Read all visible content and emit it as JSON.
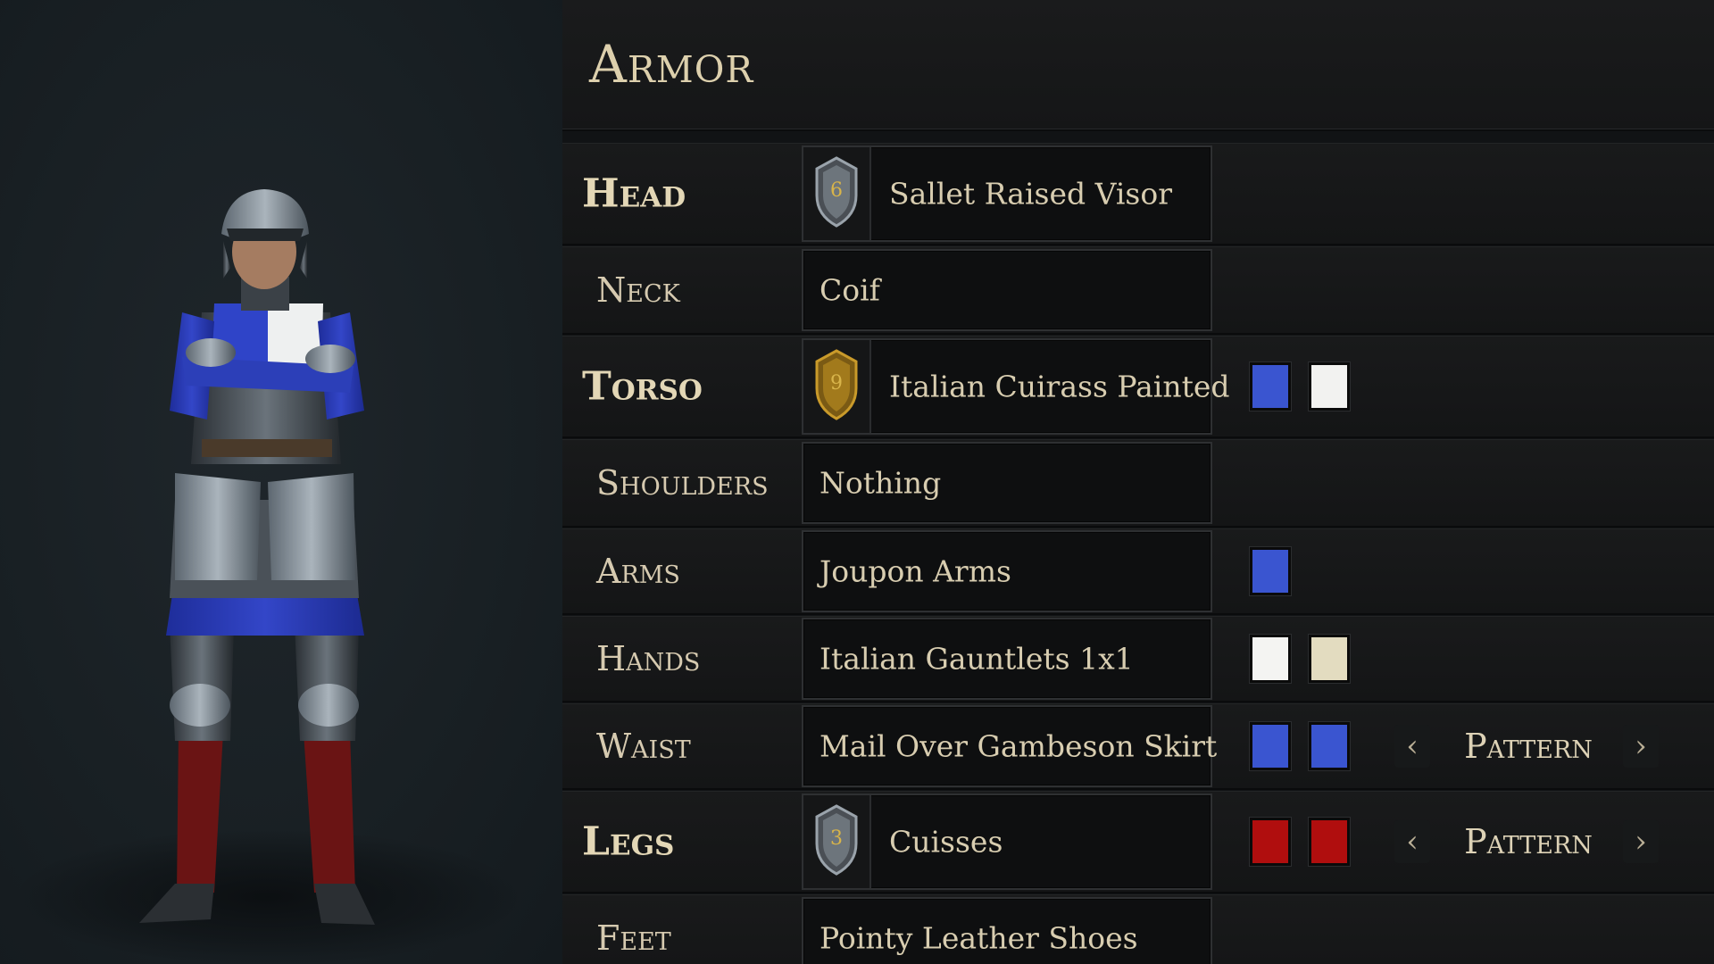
{
  "title": "Armor",
  "character": {
    "preview_label": ""
  },
  "slots": [
    {
      "id": "head",
      "label": "Head",
      "major": true,
      "item": "Sallet Raised Visor",
      "tier": "6",
      "tier_style": "silver",
      "colors": [],
      "pattern": null
    },
    {
      "id": "neck",
      "label": "Neck",
      "major": false,
      "item": "Coif",
      "colors": [],
      "pattern": null
    },
    {
      "id": "torso",
      "label": "Torso",
      "major": true,
      "item": "Italian Cuirass Painted",
      "tier": "9",
      "tier_style": "gold",
      "colors": [
        "#3a55d0",
        "#f2f2f0"
      ],
      "pattern": null
    },
    {
      "id": "shoulders",
      "label": "Shoulders",
      "major": false,
      "item": "Nothing",
      "colors": [],
      "pattern": null
    },
    {
      "id": "arms",
      "label": "Arms",
      "major": false,
      "item": "Joupon Arms",
      "colors": [
        "#3a55d0"
      ],
      "pattern": null
    },
    {
      "id": "hands",
      "label": "Hands",
      "major": false,
      "item": "Italian Gauntlets 1x1",
      "colors": [
        "#f4f4f2",
        "#e3dcc0"
      ],
      "pattern": null
    },
    {
      "id": "waist",
      "label": "Waist",
      "major": false,
      "item": "Mail Over Gambeson Skirt",
      "colors": [
        "#3a55d0",
        "#3a55d0"
      ],
      "pattern": "Pattern"
    },
    {
      "id": "legs",
      "label": "Legs",
      "major": true,
      "item": "Cuisses",
      "tier": "3",
      "tier_style": "silver",
      "colors": [
        "#b00e0e",
        "#b00e0e"
      ],
      "pattern": "Pattern"
    },
    {
      "id": "feet",
      "label": "Feet",
      "major": false,
      "item": "Pointy Leather Shoes",
      "colors": [],
      "pattern": null
    }
  ],
  "icons": {
    "prev": "chevron-left-icon",
    "next": "chevron-right-icon",
    "tier": "shield-icon"
  }
}
